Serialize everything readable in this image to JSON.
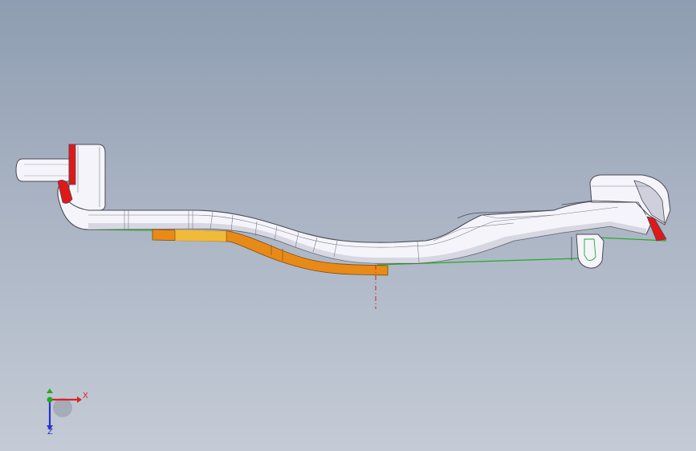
{
  "viewport": {
    "background_top": "#8e9db1",
    "background_bottom": "#c4cbd6"
  },
  "model": {
    "icon": "sheet-metal-part",
    "colors": {
      "body": "#f4f4fa",
      "body_shade": "#cfd0dc",
      "edge": "#4a4a55",
      "highlight_face": "#e07a10",
      "highlight_face_light": "#f2c240",
      "accent_face": "#e01818",
      "contact_edge": "#22aa22",
      "centerline": "#cc2222"
    }
  },
  "triad": {
    "icon": "coordinate-triad",
    "x_label": "X",
    "z_label": "Z",
    "x_color": "#dd2222",
    "y_color": "#22aa22",
    "z_color": "#2233cc"
  }
}
